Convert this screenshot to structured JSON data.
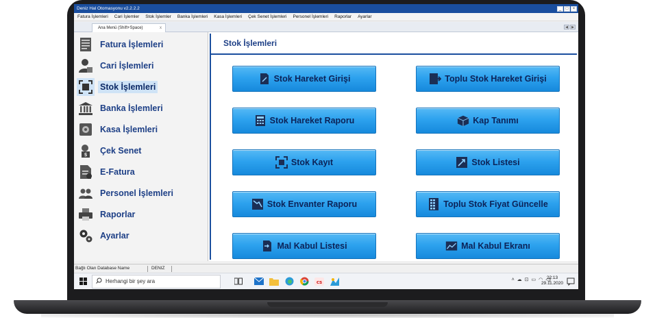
{
  "window": {
    "title": "Deniz Hal Otomasyonu v2.2.2.2",
    "minimize": "_",
    "maximize": "□",
    "close": "×"
  },
  "menu": [
    "Fatura İşlemleri",
    "Cari İşlemler",
    "Stok İşlemler",
    "Banka İşlemleri",
    "Kasa İşlemleri",
    "Çek Senet İşlemleri",
    "Personel İşlemleri",
    "Raporlar",
    "Ayarlar"
  ],
  "tabs": {
    "active_label": "Ana Menü (Shift+Space)",
    "close": "x"
  },
  "sidebar": {
    "items": [
      {
        "label": "Fatura İşlemleri",
        "icon": "invoice-icon"
      },
      {
        "label": "Cari İşlemleri",
        "icon": "person-icon"
      },
      {
        "label": "Stok İşlemleri",
        "icon": "scan-icon",
        "active": true
      },
      {
        "label": "Banka İşlemleri",
        "icon": "bank-icon"
      },
      {
        "label": "Kasa İşlemleri",
        "icon": "safe-icon"
      },
      {
        "label": "Çek Senet",
        "icon": "cheque-icon"
      },
      {
        "label": "E-Fatura",
        "icon": "e-invoice-icon"
      },
      {
        "label": "Personel İşlemleri",
        "icon": "people-icon"
      },
      {
        "label": "Raporlar",
        "icon": "printer-icon"
      },
      {
        "label": "Ayarlar",
        "icon": "gears-icon"
      }
    ]
  },
  "content": {
    "title": "Stok İşlemleri",
    "buttons": [
      {
        "label": "Stok Hareket Girişi",
        "icon": "document-pen-icon"
      },
      {
        "label": "Toplu Stok Hareket Girişi",
        "icon": "document-arrow-icon"
      },
      {
        "label": "Stok Hareket Raporu",
        "icon": "calculator-icon"
      },
      {
        "label": "Kap Tanımı",
        "icon": "box-icon"
      },
      {
        "label": "Stok Kayıt",
        "icon": "scan-icon"
      },
      {
        "label": "Stok Listesi",
        "icon": "chart-up-icon"
      },
      {
        "label": "Stok Envanter Raporu",
        "icon": "chart-down-icon"
      },
      {
        "label": "Toplu Stok Fiyat Güncelle",
        "icon": "grid-icon"
      },
      {
        "label": "Mal Kabul Listesi",
        "icon": "import-icon"
      },
      {
        "label": "Mal Kabul Ekranı",
        "icon": "image-chart-icon"
      }
    ]
  },
  "status": {
    "label": "Bağlı Olan Database Name",
    "value": "DENIZ"
  },
  "taskbar": {
    "search_placeholder": "Herhangi bir şey ara",
    "time": "22:13",
    "date": "29.11.2020"
  },
  "colors": {
    "accent": "#1a4e9e",
    "button": "#2da2ee",
    "label": "#1d3f86"
  }
}
